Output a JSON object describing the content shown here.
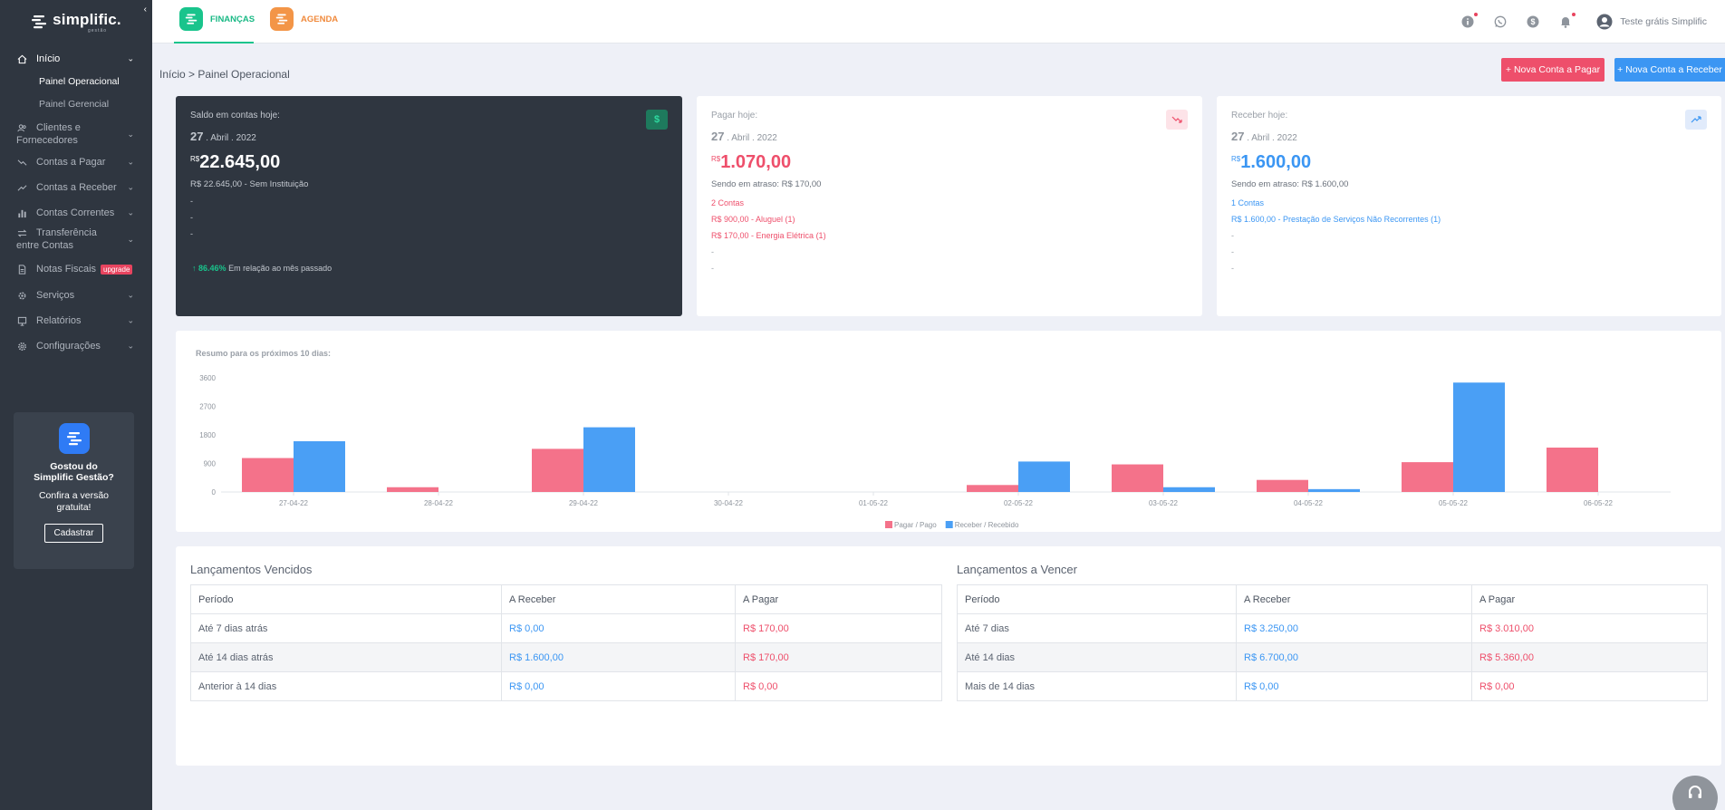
{
  "app": {
    "name": "simplific.",
    "subname": "gestão"
  },
  "sidebar": {
    "items": [
      {
        "label": "Início",
        "icon": "home-icon",
        "active": true
      },
      {
        "label": "Clientes e Fornecedores",
        "icon": "users-icon"
      },
      {
        "label": "Contas a Pagar",
        "icon": "trend-down-icon"
      },
      {
        "label": "Contas a Receber",
        "icon": "trend-up-icon"
      },
      {
        "label": "Contas Correntes",
        "icon": "bar-chart-icon"
      },
      {
        "label": "Transferência entre Contas",
        "icon": "transfer-icon"
      },
      {
        "label": "Notas Fiscais",
        "icon": "document-icon",
        "badge": "upgrade"
      },
      {
        "label": "Serviços",
        "icon": "cog-icon"
      },
      {
        "label": "Relatórios",
        "icon": "report-icon"
      },
      {
        "label": "Configurações",
        "icon": "settings-icon"
      }
    ],
    "subitems": [
      "Painel Operacional",
      "Painel Gerencial"
    ],
    "promo": {
      "title": "Gostou do Simplific Gestão?",
      "text": "Confira a versão gratuita!",
      "button": "Cadastrar"
    }
  },
  "topbar": {
    "modules": [
      "FINANÇAS",
      "AGENDA"
    ],
    "user": "Teste grátis Simplific"
  },
  "breadcrumb": "Início > Painel Operacional",
  "actions": {
    "new_payable": "+ Nova Conta a Pagar",
    "new_receivable": "+ Nova Conta a Receber"
  },
  "cards": {
    "balance": {
      "label": "Saldo em contas hoje:",
      "day": "27",
      "date_rest": ". Abril . 2022",
      "currency": "R$",
      "amount": "22.645,00",
      "detail": "R$ 22.645,00 - Sem Instituição",
      "dashes": [
        "-",
        "-",
        "-"
      ],
      "trend_value": "86.46%",
      "trend_text": "Em relação ao mês passado"
    },
    "payable": {
      "label": "Pagar hoje:",
      "day": "27",
      "date_rest": ". Abril . 2022",
      "currency": "R$",
      "amount": "1.070,00",
      "overdue": "Sendo em atraso: R$ 170,00",
      "count": "2 Contas",
      "lines": [
        "R$ 900,00 - Aluguel (1)",
        "R$ 170,00 - Energia Elétrica (1)"
      ],
      "dashes": [
        "-",
        "-"
      ]
    },
    "receivable": {
      "label": "Receber hoje:",
      "day": "27",
      "date_rest": ". Abril . 2022",
      "currency": "R$",
      "amount": "1.600,00",
      "overdue": "Sendo em atraso: R$ 1.600,00",
      "count": "1 Contas",
      "lines": [
        "R$ 1.600,00 - Prestação de Serviços Não Recorrentes (1)"
      ],
      "dashes": [
        "-",
        "-",
        "-"
      ]
    }
  },
  "chart_data": {
    "type": "bar",
    "title": "Resumo para os próximos 10 dias:",
    "categories": [
      "27-04-22",
      "28-04-22",
      "29-04-22",
      "30-04-22",
      "01-05-22",
      "02-05-22",
      "03-05-22",
      "04-05-22",
      "05-05-22",
      "06-05-22"
    ],
    "series": [
      {
        "name": "Pagar / Pago",
        "color": "#f4728a",
        "values": [
          1070,
          150,
          1360,
          0,
          0,
          220,
          870,
          380,
          940,
          1400
        ]
      },
      {
        "name": "Receber / Recebido",
        "color": "#4a9ff5",
        "values": [
          1600,
          0,
          2040,
          0,
          0,
          960,
          150,
          90,
          3450,
          0
        ]
      }
    ],
    "yticks": [
      0,
      900,
      1800,
      2700,
      3600
    ],
    "ylim": [
      0,
      3600
    ],
    "legend": "bottom",
    "grid": false
  },
  "tables": {
    "overdue": {
      "title": "Lançamentos Vencidos",
      "headers": [
        "Período",
        "A Receber",
        "A Pagar"
      ],
      "rows": [
        [
          "Até 7 dias atrás",
          "R$ 0,00",
          "R$ 170,00"
        ],
        [
          "Até 14 dias atrás",
          "R$ 1.600,00",
          "R$ 170,00"
        ],
        [
          "Anterior à 14 dias",
          "R$ 0,00",
          "R$ 0,00"
        ]
      ]
    },
    "upcoming": {
      "title": "Lançamentos a Vencer",
      "headers": [
        "Período",
        "A Receber",
        "A Pagar"
      ],
      "rows": [
        [
          "Até 7 dias",
          "R$ 3.250,00",
          "R$ 3.010,00"
        ],
        [
          "Até 14 dias",
          "R$ 6.700,00",
          "R$ 5.360,00"
        ],
        [
          "Mais de 14 dias",
          "R$ 0,00",
          "R$ 0,00"
        ]
      ]
    }
  }
}
